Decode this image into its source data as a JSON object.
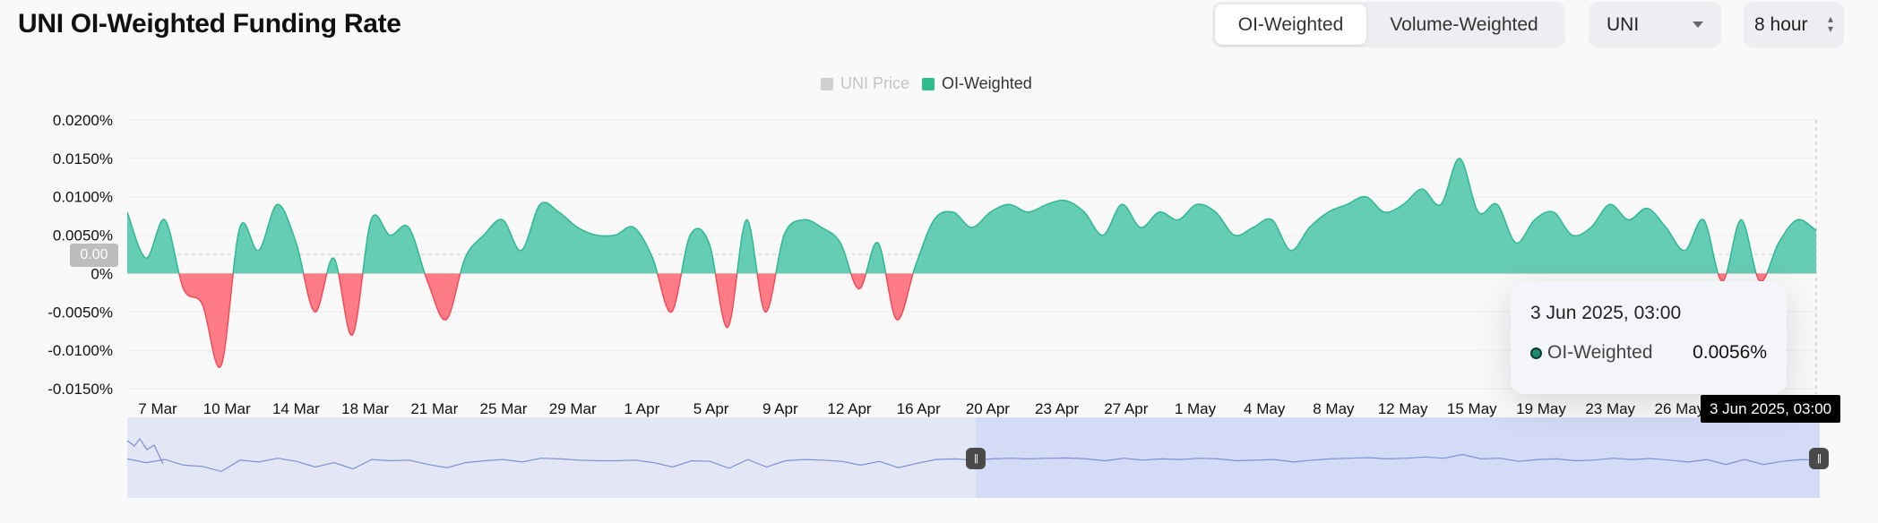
{
  "header": {
    "title": "UNI OI-Weighted Funding Rate",
    "segments": [
      "OI-Weighted",
      "Volume-Weighted"
    ],
    "active_segment": "OI-Weighted",
    "coin_select": "UNI",
    "interval_select": "8 hour"
  },
  "legend": [
    {
      "label": "UNI Price",
      "color": "#c8c8c8",
      "enabled": false
    },
    {
      "label": "OI-Weighted",
      "color": "#2ebd8a",
      "enabled": true
    }
  ],
  "tooltip": {
    "date": "3 Jun 2025, 03:00",
    "series": "OI-Weighted",
    "value": "0.0056%"
  },
  "crosshair_label": "3 Jun 2025, 03:00",
  "zero_tag": "0.00",
  "colors": {
    "positive_fill": "#66cdb5",
    "positive_stroke": "#2fb891",
    "negative_fill": "#ff7c86",
    "negative_stroke": "#f04b59",
    "navigator_fill": "#e3e7f5",
    "navigator_selected": "#d3dbf6",
    "navigator_line": "#7d8fd6"
  },
  "chart_data": {
    "type": "area",
    "title": "UNI OI-Weighted Funding Rate",
    "series_name": "OI-Weighted",
    "y_unit": "%",
    "ylim": [
      -0.015,
      0.02
    ],
    "y_ticks": [
      {
        "value": 0.02,
        "label": "0.0200%"
      },
      {
        "value": 0.015,
        "label": "0.0150%"
      },
      {
        "value": 0.01,
        "label": "0.0100%"
      },
      {
        "value": 0.005,
        "label": "0.0050%"
      },
      {
        "value": 0,
        "label": "0%"
      },
      {
        "value": -0.005,
        "label": "-0.0050%"
      },
      {
        "value": -0.01,
        "label": "-0.0100%"
      },
      {
        "value": -0.015,
        "label": "-0.0150%"
      }
    ],
    "x_ticks": [
      "7 Mar",
      "10 Mar",
      "14 Mar",
      "18 Mar",
      "21 Mar",
      "25 Mar",
      "29 Mar",
      "1 Apr",
      "5 Apr",
      "9 Apr",
      "12 Apr",
      "16 Apr",
      "20 Apr",
      "23 Apr",
      "27 Apr",
      "1 May",
      "4 May",
      "8 May",
      "12 May",
      "15 May",
      "19 May",
      "23 May",
      "26 May"
    ],
    "x_range": [
      "5 Mar 2025",
      "3 Jun 2025"
    ],
    "grid": true,
    "legend_position": "top-center",
    "x": [
      "5 Mar",
      "6 Mar",
      "7 Mar",
      "8 Mar",
      "9 Mar",
      "10 Mar",
      "11 Mar",
      "12 Mar",
      "13 Mar",
      "14 Mar",
      "15 Mar",
      "16 Mar",
      "17 Mar",
      "18 Mar",
      "19 Mar",
      "20 Mar",
      "21 Mar",
      "22 Mar",
      "23 Mar",
      "24 Mar",
      "25 Mar",
      "26 Mar",
      "27 Mar",
      "28 Mar",
      "29 Mar",
      "30 Mar",
      "31 Mar",
      "1 Apr",
      "2 Apr",
      "3 Apr",
      "4 Apr",
      "5 Apr",
      "6 Apr",
      "7 Apr",
      "8 Apr",
      "9 Apr",
      "10 Apr",
      "11 Apr",
      "12 Apr",
      "13 Apr",
      "14 Apr",
      "15 Apr",
      "16 Apr",
      "17 Apr",
      "18 Apr",
      "19 Apr",
      "20 Apr",
      "21 Apr",
      "22 Apr",
      "23 Apr",
      "24 Apr",
      "25 Apr",
      "26 Apr",
      "27 Apr",
      "28 Apr",
      "29 Apr",
      "30 Apr",
      "1 May",
      "2 May",
      "3 May",
      "4 May",
      "5 May",
      "6 May",
      "7 May",
      "8 May",
      "9 May",
      "10 May",
      "11 May",
      "12 May",
      "13 May",
      "14 May",
      "15 May",
      "16 May",
      "17 May",
      "18 May",
      "19 May",
      "20 May",
      "21 May",
      "22 May",
      "23 May",
      "24 May",
      "25 May",
      "26 May",
      "27 May",
      "28 May",
      "29 May",
      "30 May",
      "31 May",
      "1 Jun",
      "2 Jun",
      "3 Jun"
    ],
    "values": [
      0.008,
      0.002,
      0.007,
      -0.002,
      -0.004,
      -0.012,
      0.006,
      0.003,
      0.009,
      0.004,
      -0.005,
      0.002,
      -0.008,
      0.007,
      0.005,
      0.006,
      -0.001,
      -0.006,
      0.002,
      0.005,
      0.007,
      0.003,
      0.009,
      0.008,
      0.006,
      0.005,
      0.005,
      0.006,
      0.002,
      -0.005,
      0.005,
      0.004,
      -0.007,
      0.007,
      -0.005,
      0.005,
      0.007,
      0.006,
      0.004,
      -0.002,
      0.004,
      -0.006,
      0.001,
      0.007,
      0.008,
      0.006,
      0.008,
      0.009,
      0.008,
      0.009,
      0.0095,
      0.008,
      0.005,
      0.009,
      0.006,
      0.008,
      0.007,
      0.009,
      0.008,
      0.005,
      0.006,
      0.007,
      0.003,
      0.006,
      0.008,
      0.009,
      0.01,
      0.008,
      0.009,
      0.011,
      0.009,
      0.015,
      0.008,
      0.009,
      0.004,
      0.007,
      0.008,
      0.005,
      0.006,
      0.009,
      0.007,
      0.0085,
      0.006,
      0.003,
      0.007,
      -0.001,
      0.007,
      -0.001,
      0.004,
      0.007,
      0.0056
    ]
  },
  "navigator": {
    "selected_start": "19 Apr",
    "selected_end": "3 Jun"
  }
}
